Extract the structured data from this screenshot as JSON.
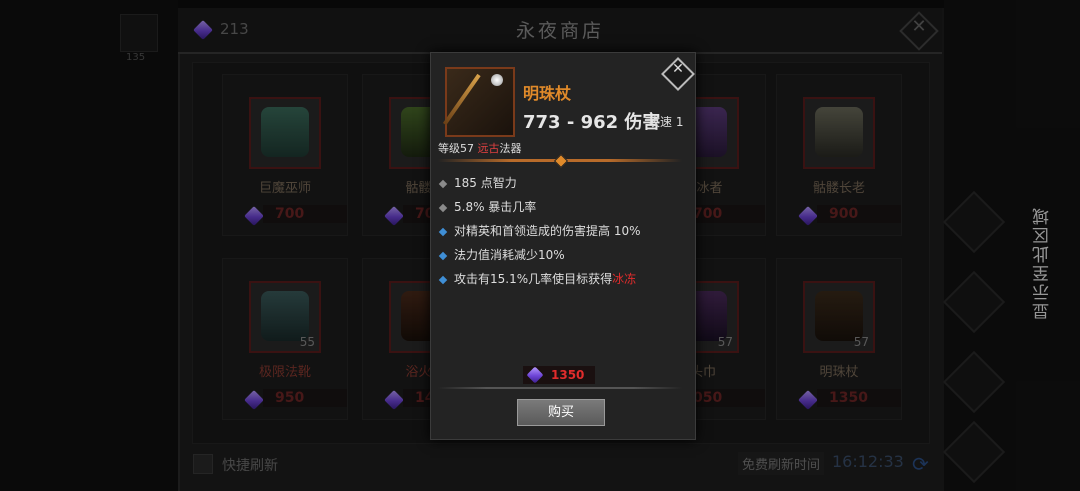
{
  "header": {
    "title": "永夜商店",
    "currency": "213",
    "left_level": "135"
  },
  "cards": [
    {
      "name": "巨魔巫师",
      "price": "700",
      "level": "",
      "name_red": false
    },
    {
      "name": "骷髅施",
      "price": "70",
      "level": "",
      "name_red": false
    },
    {
      "name": "喷冰者",
      "price": "700",
      "level": "",
      "name_red": false
    },
    {
      "name": "骷髅长老",
      "price": "900",
      "level": "",
      "name_red": false
    },
    {
      "name": "极限法靴",
      "price": "950",
      "level": "55",
      "name_red": true
    },
    {
      "name": "浴火炎",
      "price": "14",
      "level": "",
      "name_red": true
    },
    {
      "name": "头巾",
      "price": "050",
      "level": "57",
      "name_red": false
    },
    {
      "name": "明珠杖",
      "price": "1350",
      "level": "57",
      "name_red": false
    }
  ],
  "footer": {
    "quick_refresh": "快捷刷新",
    "free_refresh_label": "免费刷新时间",
    "timer": "16:12:33"
  },
  "side_text": "显示至此区域",
  "popup": {
    "name": "明珠杖",
    "damage": "773 - 962 伤害",
    "speed": "攻速 1",
    "level_prefix": "等级57 ",
    "level_type": "远古",
    "level_suffix": "法器",
    "stats": [
      {
        "text": "185 点智力",
        "color": "gray"
      },
      {
        "text": "5.8% 暴击几率",
        "color": "gray"
      },
      {
        "text": "对精英和首领造成的伤害提高 10%",
        "color": "blue"
      },
      {
        "text": "法力值消耗减少10%",
        "color": "blue"
      },
      {
        "text": "攻击有15.1%几率使目标获得",
        "highlight": "冰冻",
        "color": "blue"
      }
    ],
    "price": "1350",
    "buy_label": "购买"
  },
  "colors": {
    "accent_orange": "#e08a2a",
    "price_red": "#e02c2c",
    "bullet_blue": "#3f8fd6",
    "gem_purple": "#7a4ce0"
  }
}
